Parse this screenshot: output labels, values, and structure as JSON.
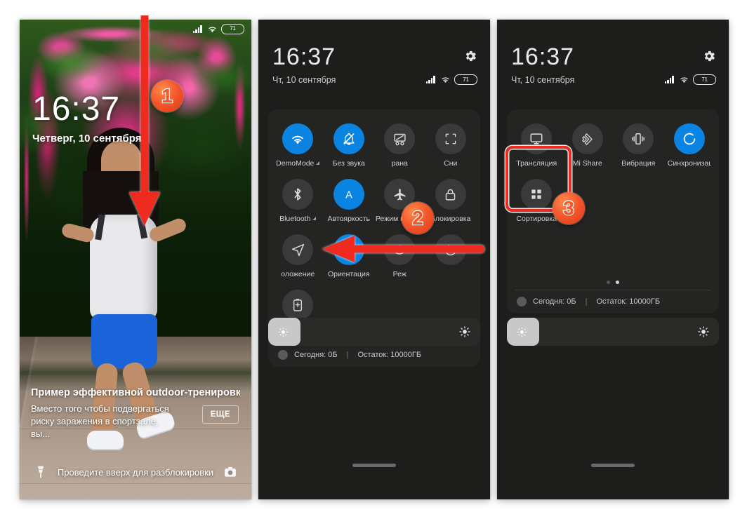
{
  "screens": [
    {
      "id": "lockscreen",
      "statusbar": {
        "battery": "71",
        "signal_icon": "signal-bars-icon",
        "wifi_icon": "wifi-icon"
      },
      "clock": {
        "time": "16:37",
        "date": "Четверг, 10 сентября"
      },
      "notification": {
        "title": "Пример эффективной outdoor-тренировки ...",
        "body": "Вместо того чтобы подвергаться риску заражения в спортзале, вы...",
        "more_button": "ЕЩЕ"
      },
      "bottom": {
        "left_icon": "flashlight-icon",
        "hint": "Проведите вверх для разблокировки",
        "right_icon": "camera-icon"
      }
    },
    {
      "id": "control-center-page-1",
      "header": {
        "time": "16:37",
        "date": "Чт, 10 сентября",
        "settings_icon": "gear-icon",
        "battery": "71"
      },
      "tiles": [
        {
          "label": "DemoMode",
          "icon": "wifi-icon",
          "on": true,
          "caret": true,
          "clip": false
        },
        {
          "label": "Без звука",
          "icon": "bell-mute-icon",
          "on": true,
          "caret": false,
          "clip": false
        },
        {
          "label": "рана",
          "icon": "screen-record-icon",
          "on": false,
          "caret": false,
          "clip": false
        },
        {
          "label": "Сни",
          "icon": "screenshot-icon",
          "on": false,
          "caret": false,
          "clip": false
        },
        {
          "label": "Bluetooth",
          "icon": "bluetooth-icon",
          "on": false,
          "caret": true,
          "clip": false
        },
        {
          "label": "Автояркость",
          "icon": "auto-brightness-icon",
          "on": true,
          "caret": false,
          "clip": false
        },
        {
          "label": "Режим полета",
          "icon": "airplane-icon",
          "on": false,
          "caret": false,
          "clip": false
        },
        {
          "label": "Блокировка",
          "icon": "lock-icon",
          "on": false,
          "caret": false,
          "clip": false
        },
        {
          "label": "оложение",
          "icon": "location-icon",
          "on": false,
          "caret": false,
          "clip": false
        },
        {
          "label": "Ориентация",
          "icon": "rotation-lock-icon",
          "on": true,
          "caret": false,
          "clip": false
        },
        {
          "label": "Реж",
          "icon": "eye-icon",
          "on": false,
          "caret": false,
          "clip": false
        },
        {
          "label": "",
          "icon": "moon-icon",
          "on": false,
          "caret": false,
          "clip": false
        },
        {
          "label": "",
          "icon": "battery-saver-icon",
          "on": false,
          "caret": false,
          "clip": false
        }
      ],
      "pager": {
        "pages": 2,
        "active": 0
      },
      "data_usage": {
        "today_label": "Сегодня: 0Б",
        "separator": "|",
        "remaining_label": "Остаток: 10000ГБ"
      },
      "brightness": {
        "left_icon": "auto-brightness-small-icon",
        "right_icon": "brightness-sun-icon",
        "fill_percent": 15
      }
    },
    {
      "id": "control-center-page-2",
      "header": {
        "time": "16:37",
        "date": "Чт, 10 сентября",
        "settings_icon": "gear-icon",
        "battery": "71"
      },
      "tiles": [
        {
          "label": "Трансляция",
          "icon": "cast-icon",
          "on": false
        },
        {
          "label": "Mi Share",
          "icon": "mi-share-icon",
          "on": false
        },
        {
          "label": "Вибрация",
          "icon": "vibration-icon",
          "on": false
        },
        {
          "label": "Синхронизаци",
          "icon": "sync-icon",
          "on": true
        }
      ],
      "tiles_row2": [
        {
          "label": "Сортировка",
          "icon": "grid-sort-icon",
          "on": false,
          "highlighted": true
        }
      ],
      "pager": {
        "pages": 2,
        "active": 1
      },
      "data_usage": {
        "today_label": "Сегодня: 0Б",
        "separator": "|",
        "remaining_label": "Остаток: 10000ГБ"
      },
      "brightness": {
        "left_icon": "auto-brightness-small-icon",
        "right_icon": "brightness-sun-icon",
        "fill_percent": 15
      }
    }
  ],
  "annotations": {
    "step1": "1",
    "step2": "2",
    "step3": "3",
    "accent_color": "#ee2b1e",
    "badge_color": "#f4562a"
  }
}
